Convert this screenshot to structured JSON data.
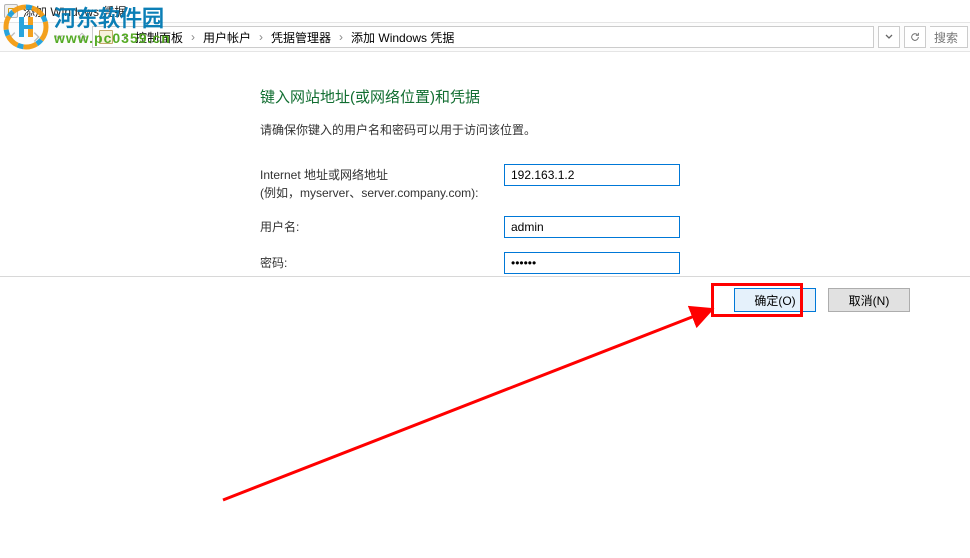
{
  "watermark": {
    "name": "河东软件园",
    "url": "www.pc0359.cn"
  },
  "titlebar": {
    "title": "添加 Windows 凭据"
  },
  "breadcrumb": {
    "items": [
      "控制面板",
      "用户帐户",
      "凭据管理器",
      "添加 Windows 凭据"
    ]
  },
  "search": {
    "placeholder": "搜索"
  },
  "page": {
    "title": "键入网站地址(或网络位置)和凭据",
    "subtitle": "请确保你键入的用户名和密码可以用于访问该位置。"
  },
  "form": {
    "address": {
      "label": "Internet 地址或网络地址",
      "hint": "(例如，myserver、server.company.com):",
      "value": "192.163.1.2"
    },
    "username": {
      "label": "用户名:",
      "value": "admin"
    },
    "password": {
      "label": "密码:",
      "value": "••••••"
    }
  },
  "buttons": {
    "ok": "确定(O)",
    "cancel": "取消(N)"
  }
}
